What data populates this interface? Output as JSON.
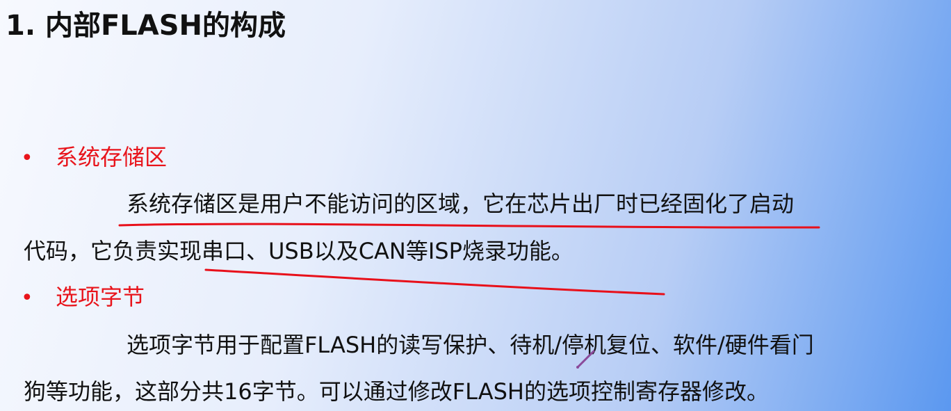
{
  "slide": {
    "title": "1. 内部FLASH的构成",
    "sections": [
      {
        "bullet": "•",
        "heading": "系统存储区",
        "lines": [
          "系统存储区是用户不能访问的区域，它在芯片出厂时已经固化了启动",
          "代码，它负责实现串口、USB以及CAN等ISP烧录功能。"
        ]
      },
      {
        "bullet": "•",
        "heading": "选项字节",
        "lines": [
          "选项字节用于配置FLASH的读写保护、待机/停机复位、软件/硬件看门",
          "狗等功能，这部分共16字节。可以通过修改FLASH的选项控制寄存器修改。"
        ]
      }
    ]
  },
  "annotations": {
    "ink_color": "#e8101a",
    "pen_cursor_color": "#8a4a9a"
  }
}
